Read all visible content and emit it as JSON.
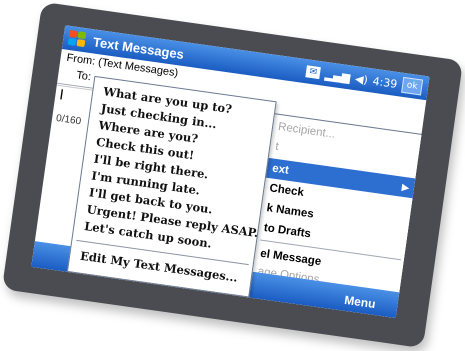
{
  "window": {
    "title": "Text Messages"
  },
  "status": {
    "ok_label": "ok",
    "time": "4:39"
  },
  "header": {
    "from_label": "From:",
    "from_value": "(Text Messages)",
    "to_label": "To:"
  },
  "body": {
    "cursor": "I",
    "char_count": "0/160"
  },
  "my_text": {
    "items": [
      "What are you up to?",
      "Just checking in...",
      "Where are you?",
      "Check this out!",
      "I'll be right there.",
      "I'm running late.",
      "I'll get back to you.",
      "Urgent! Please reply ASAP.",
      "Let's catch up soon."
    ],
    "edit_label": "Edit My Text Messages..."
  },
  "menu": {
    "items": [
      {
        "label": "Recipient...",
        "state": "disabled"
      },
      {
        "label": "t",
        "state": "disabled"
      },
      {
        "label": "ext",
        "state": "selected"
      },
      {
        "label": "Check",
        "state": "bold"
      },
      {
        "label": "k Names",
        "state": "bold"
      },
      {
        "label": "to Drafts",
        "state": "bold"
      },
      {
        "label": "el Message",
        "state": "bold"
      },
      {
        "label": "age Options...",
        "state": "disabled"
      }
    ],
    "menu_button": "Menu"
  },
  "colors": {
    "titlebar": "#1a5cc2",
    "selection": "#2d6fd1",
    "bezel": "#4a4c51"
  }
}
